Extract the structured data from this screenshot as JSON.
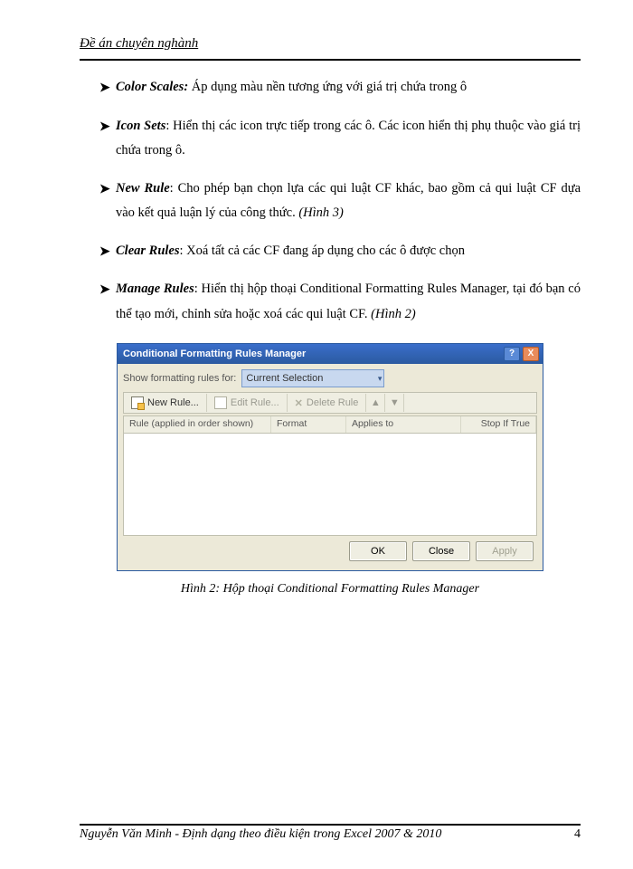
{
  "header": {
    "title": "Đề án chuyên nghành"
  },
  "bullets": [
    {
      "label": "Color Scales:",
      "text": " Áp dụng màu nền tương ứng với giá trị chứa trong ô"
    },
    {
      "label": "Icon Sets",
      "text": ": Hiển thị các icon trực tiếp trong các ô. Các icon hiển thị phụ thuộc vào giá trị chứa trong ô."
    },
    {
      "label": "New Rule",
      "text": ": Cho phép bạn chọn lựa các qui luật CF khác, bao gồm cả qui luật CF dựa vào kết quả luận lý của công thức. ",
      "figref": "(Hình 3)"
    },
    {
      "label": "Clear Rules",
      "text": ": Xoá tất cả các CF đang áp dụng cho các ô được chọn"
    },
    {
      "label": "Manage Rules",
      "text": ": Hiển thị hộp thoại Conditional Formatting Rules Manager, tại đó bạn có thể tạo mới, chỉnh sửa hoặc xoá các qui luật CF. ",
      "figref": "(Hình 2)"
    }
  ],
  "dialog": {
    "title": "Conditional Formatting Rules Manager",
    "help": "?",
    "close": "X",
    "show_label": "Show formatting rules for:",
    "select_value": "Current Selection",
    "btn_new": "New Rule...",
    "btn_edit": "Edit Rule...",
    "btn_delete": "Delete Rule",
    "arrow_up": "▲",
    "arrow_down": "▼",
    "hd_rule": "Rule (applied in order shown)",
    "hd_format": "Format",
    "hd_applies": "Applies to",
    "hd_stop": "Stop If True",
    "ok": "OK",
    "close_btn": "Close",
    "apply": "Apply"
  },
  "caption": "Hình 2: Hộp thoại Conditional Formatting Rules Manager",
  "footer": {
    "text": "Nguyễn Văn Minh - Định dạng theo điều kiện trong Excel 2007 & 2010",
    "page": "4"
  }
}
